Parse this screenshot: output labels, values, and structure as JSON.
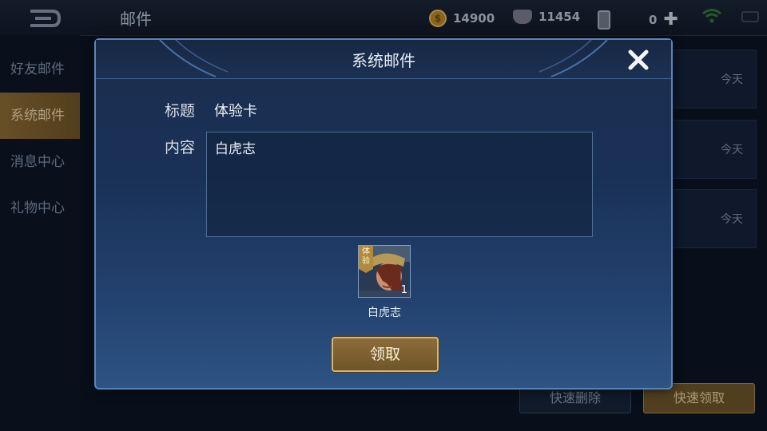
{
  "header": {
    "title": "邮件",
    "gold": "14900",
    "diamonds": "11454",
    "cards": "0"
  },
  "sidebar": {
    "items": [
      {
        "label": "好友邮件"
      },
      {
        "label": "系统邮件"
      },
      {
        "label": "消息中心"
      },
      {
        "label": "礼物中心"
      }
    ]
  },
  "mail_list": {
    "rows": [
      {
        "date": "今天"
      },
      {
        "date": "今天"
      },
      {
        "date": "今天"
      }
    ]
  },
  "bottom": {
    "quick_delete": "快速删除",
    "quick_claim": "快速领取"
  },
  "modal": {
    "title": "系统邮件",
    "subject_label": "标题",
    "subject_value": "体验卡",
    "content_label": "内容",
    "content_value": "白虎志",
    "item": {
      "badge": "体验",
      "count": "1",
      "name": "白虎志"
    },
    "claim_button": "领取"
  },
  "colors": {
    "accent_gold": "#d5b574",
    "modal_border": "#5b85b9",
    "active_tab": "#8a6a35"
  }
}
